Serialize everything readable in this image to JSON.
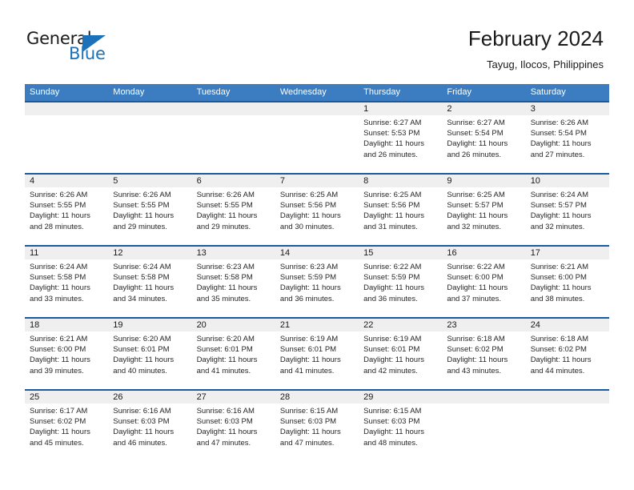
{
  "brand": {
    "name_part1": "General",
    "name_part2": "Blue",
    "accent_color": "#1b72b8"
  },
  "header": {
    "title": "February 2024",
    "subtitle": "Tayug, Ilocos, Philippines"
  },
  "theme": {
    "header_row_bg": "#3b7dc0",
    "row_divider": "#1b5a9e",
    "date_band_bg": "#efefef"
  },
  "weekdays": [
    "Sunday",
    "Monday",
    "Tuesday",
    "Wednesday",
    "Thursday",
    "Friday",
    "Saturday"
  ],
  "labels": {
    "sunrise": "Sunrise:",
    "sunset": "Sunset:",
    "daylight": "Daylight:"
  },
  "weeks": [
    [
      {
        "day": "",
        "sunrise": "",
        "sunset": "",
        "daylight": "",
        "empty": true
      },
      {
        "day": "",
        "sunrise": "",
        "sunset": "",
        "daylight": "",
        "empty": true
      },
      {
        "day": "",
        "sunrise": "",
        "sunset": "",
        "daylight": "",
        "empty": true
      },
      {
        "day": "",
        "sunrise": "",
        "sunset": "",
        "daylight": "",
        "empty": true
      },
      {
        "day": "1",
        "sunrise": "Sunrise: 6:27 AM",
        "sunset": "Sunset: 5:53 PM",
        "daylight": "Daylight: 11 hours and 26 minutes."
      },
      {
        "day": "2",
        "sunrise": "Sunrise: 6:27 AM",
        "sunset": "Sunset: 5:54 PM",
        "daylight": "Daylight: 11 hours and 26 minutes."
      },
      {
        "day": "3",
        "sunrise": "Sunrise: 6:26 AM",
        "sunset": "Sunset: 5:54 PM",
        "daylight": "Daylight: 11 hours and 27 minutes."
      }
    ],
    [
      {
        "day": "4",
        "sunrise": "Sunrise: 6:26 AM",
        "sunset": "Sunset: 5:55 PM",
        "daylight": "Daylight: 11 hours and 28 minutes."
      },
      {
        "day": "5",
        "sunrise": "Sunrise: 6:26 AM",
        "sunset": "Sunset: 5:55 PM",
        "daylight": "Daylight: 11 hours and 29 minutes."
      },
      {
        "day": "6",
        "sunrise": "Sunrise: 6:26 AM",
        "sunset": "Sunset: 5:55 PM",
        "daylight": "Daylight: 11 hours and 29 minutes."
      },
      {
        "day": "7",
        "sunrise": "Sunrise: 6:25 AM",
        "sunset": "Sunset: 5:56 PM",
        "daylight": "Daylight: 11 hours and 30 minutes."
      },
      {
        "day": "8",
        "sunrise": "Sunrise: 6:25 AM",
        "sunset": "Sunset: 5:56 PM",
        "daylight": "Daylight: 11 hours and 31 minutes."
      },
      {
        "day": "9",
        "sunrise": "Sunrise: 6:25 AM",
        "sunset": "Sunset: 5:57 PM",
        "daylight": "Daylight: 11 hours and 32 minutes."
      },
      {
        "day": "10",
        "sunrise": "Sunrise: 6:24 AM",
        "sunset": "Sunset: 5:57 PM",
        "daylight": "Daylight: 11 hours and 32 minutes."
      }
    ],
    [
      {
        "day": "11",
        "sunrise": "Sunrise: 6:24 AM",
        "sunset": "Sunset: 5:58 PM",
        "daylight": "Daylight: 11 hours and 33 minutes."
      },
      {
        "day": "12",
        "sunrise": "Sunrise: 6:24 AM",
        "sunset": "Sunset: 5:58 PM",
        "daylight": "Daylight: 11 hours and 34 minutes."
      },
      {
        "day": "13",
        "sunrise": "Sunrise: 6:23 AM",
        "sunset": "Sunset: 5:58 PM",
        "daylight": "Daylight: 11 hours and 35 minutes."
      },
      {
        "day": "14",
        "sunrise": "Sunrise: 6:23 AM",
        "sunset": "Sunset: 5:59 PM",
        "daylight": "Daylight: 11 hours and 36 minutes."
      },
      {
        "day": "15",
        "sunrise": "Sunrise: 6:22 AM",
        "sunset": "Sunset: 5:59 PM",
        "daylight": "Daylight: 11 hours and 36 minutes."
      },
      {
        "day": "16",
        "sunrise": "Sunrise: 6:22 AM",
        "sunset": "Sunset: 6:00 PM",
        "daylight": "Daylight: 11 hours and 37 minutes."
      },
      {
        "day": "17",
        "sunrise": "Sunrise: 6:21 AM",
        "sunset": "Sunset: 6:00 PM",
        "daylight": "Daylight: 11 hours and 38 minutes."
      }
    ],
    [
      {
        "day": "18",
        "sunrise": "Sunrise: 6:21 AM",
        "sunset": "Sunset: 6:00 PM",
        "daylight": "Daylight: 11 hours and 39 minutes."
      },
      {
        "day": "19",
        "sunrise": "Sunrise: 6:20 AM",
        "sunset": "Sunset: 6:01 PM",
        "daylight": "Daylight: 11 hours and 40 minutes."
      },
      {
        "day": "20",
        "sunrise": "Sunrise: 6:20 AM",
        "sunset": "Sunset: 6:01 PM",
        "daylight": "Daylight: 11 hours and 41 minutes."
      },
      {
        "day": "21",
        "sunrise": "Sunrise: 6:19 AM",
        "sunset": "Sunset: 6:01 PM",
        "daylight": "Daylight: 11 hours and 41 minutes."
      },
      {
        "day": "22",
        "sunrise": "Sunrise: 6:19 AM",
        "sunset": "Sunset: 6:01 PM",
        "daylight": "Daylight: 11 hours and 42 minutes."
      },
      {
        "day": "23",
        "sunrise": "Sunrise: 6:18 AM",
        "sunset": "Sunset: 6:02 PM",
        "daylight": "Daylight: 11 hours and 43 minutes."
      },
      {
        "day": "24",
        "sunrise": "Sunrise: 6:18 AM",
        "sunset": "Sunset: 6:02 PM",
        "daylight": "Daylight: 11 hours and 44 minutes."
      }
    ],
    [
      {
        "day": "25",
        "sunrise": "Sunrise: 6:17 AM",
        "sunset": "Sunset: 6:02 PM",
        "daylight": "Daylight: 11 hours and 45 minutes."
      },
      {
        "day": "26",
        "sunrise": "Sunrise: 6:16 AM",
        "sunset": "Sunset: 6:03 PM",
        "daylight": "Daylight: 11 hours and 46 minutes."
      },
      {
        "day": "27",
        "sunrise": "Sunrise: 6:16 AM",
        "sunset": "Sunset: 6:03 PM",
        "daylight": "Daylight: 11 hours and 47 minutes."
      },
      {
        "day": "28",
        "sunrise": "Sunrise: 6:15 AM",
        "sunset": "Sunset: 6:03 PM",
        "daylight": "Daylight: 11 hours and 47 minutes."
      },
      {
        "day": "29",
        "sunrise": "Sunrise: 6:15 AM",
        "sunset": "Sunset: 6:03 PM",
        "daylight": "Daylight: 11 hours and 48 minutes."
      },
      {
        "day": "",
        "sunrise": "",
        "sunset": "",
        "daylight": "",
        "empty": true
      },
      {
        "day": "",
        "sunrise": "",
        "sunset": "",
        "daylight": "",
        "empty": true
      }
    ]
  ]
}
